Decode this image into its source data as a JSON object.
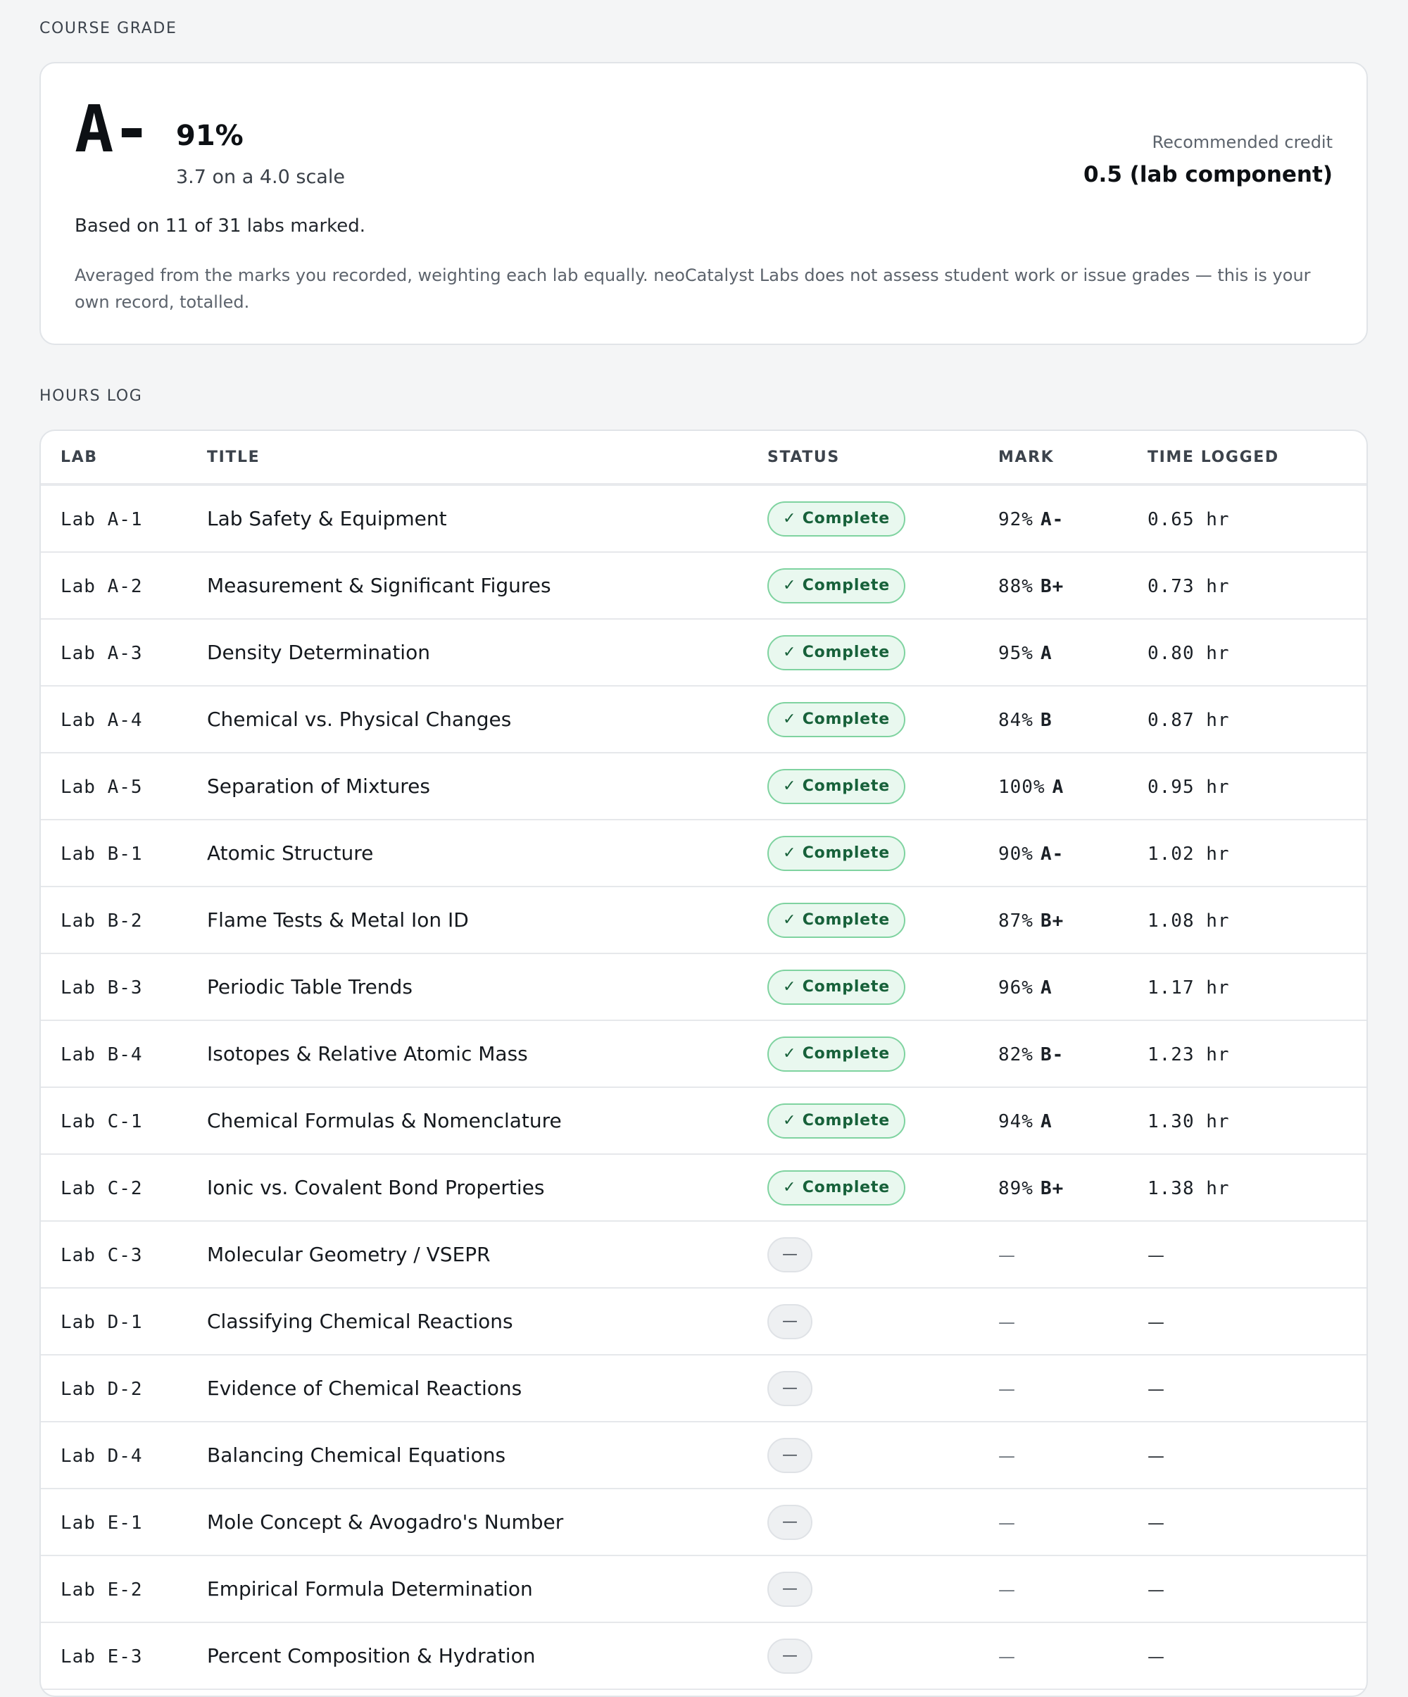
{
  "course_grade": {
    "section_label": "COURSE GRADE",
    "letter": "A-",
    "percent": "91%",
    "scale": "3.7 on a 4.0 scale",
    "credit_label": "Recommended credit",
    "credit_value": "0.5 (lab component)",
    "based_on": "Based on 11 of 31 labs marked.",
    "disclaimer": "Averaged from the marks you recorded, weighting each lab equally. neoCatalyst Labs does not assess student work or issue grades — this is your own record, totalled."
  },
  "hours_log": {
    "section_label": "HOURS LOG",
    "columns": [
      "LAB",
      "TITLE",
      "STATUS",
      "MARK",
      "TIME LOGGED"
    ],
    "status_complete_label": "✓ Complete",
    "status_none_label": "—",
    "empty_value": "—",
    "rows": [
      {
        "lab": "Lab A-1",
        "title": "Lab Safety & Equipment",
        "status": "complete",
        "percent": "92%",
        "letter": "A-",
        "time": "0.65 hr"
      },
      {
        "lab": "Lab A-2",
        "title": "Measurement & Significant Figures",
        "status": "complete",
        "percent": "88%",
        "letter": "B+",
        "time": "0.73 hr"
      },
      {
        "lab": "Lab A-3",
        "title": "Density Determination",
        "status": "complete",
        "percent": "95%",
        "letter": "A",
        "time": "0.80 hr"
      },
      {
        "lab": "Lab A-4",
        "title": "Chemical vs. Physical Changes",
        "status": "complete",
        "percent": "84%",
        "letter": "B",
        "time": "0.87 hr"
      },
      {
        "lab": "Lab A-5",
        "title": "Separation of Mixtures",
        "status": "complete",
        "percent": "100%",
        "letter": "A",
        "time": "0.95 hr"
      },
      {
        "lab": "Lab B-1",
        "title": "Atomic Structure",
        "status": "complete",
        "percent": "90%",
        "letter": "A-",
        "time": "1.02 hr"
      },
      {
        "lab": "Lab B-2",
        "title": "Flame Tests & Metal Ion ID",
        "status": "complete",
        "percent": "87%",
        "letter": "B+",
        "time": "1.08 hr"
      },
      {
        "lab": "Lab B-3",
        "title": "Periodic Table Trends",
        "status": "complete",
        "percent": "96%",
        "letter": "A",
        "time": "1.17 hr"
      },
      {
        "lab": "Lab B-4",
        "title": "Isotopes & Relative Atomic Mass",
        "status": "complete",
        "percent": "82%",
        "letter": "B-",
        "time": "1.23 hr"
      },
      {
        "lab": "Lab C-1",
        "title": "Chemical Formulas & Nomenclature",
        "status": "complete",
        "percent": "94%",
        "letter": "A",
        "time": "1.30 hr"
      },
      {
        "lab": "Lab C-2",
        "title": "Ionic vs. Covalent Bond Properties",
        "status": "complete",
        "percent": "89%",
        "letter": "B+",
        "time": "1.38 hr"
      },
      {
        "lab": "Lab C-3",
        "title": "Molecular Geometry / VSEPR",
        "status": "none",
        "percent": "",
        "letter": "",
        "time": ""
      },
      {
        "lab": "Lab D-1",
        "title": "Classifying Chemical Reactions",
        "status": "none",
        "percent": "",
        "letter": "",
        "time": ""
      },
      {
        "lab": "Lab D-2",
        "title": "Evidence of Chemical Reactions",
        "status": "none",
        "percent": "",
        "letter": "",
        "time": ""
      },
      {
        "lab": "Lab D-4",
        "title": "Balancing Chemical Equations",
        "status": "none",
        "percent": "",
        "letter": "",
        "time": ""
      },
      {
        "lab": "Lab E-1",
        "title": "Mole Concept & Avogadro's Number",
        "status": "none",
        "percent": "",
        "letter": "",
        "time": ""
      },
      {
        "lab": "Lab E-2",
        "title": "Empirical Formula Determination",
        "status": "none",
        "percent": "",
        "letter": "",
        "time": ""
      },
      {
        "lab": "Lab E-3",
        "title": "Percent Composition & Hydration",
        "status": "none",
        "percent": "",
        "letter": "",
        "time": ""
      }
    ]
  }
}
